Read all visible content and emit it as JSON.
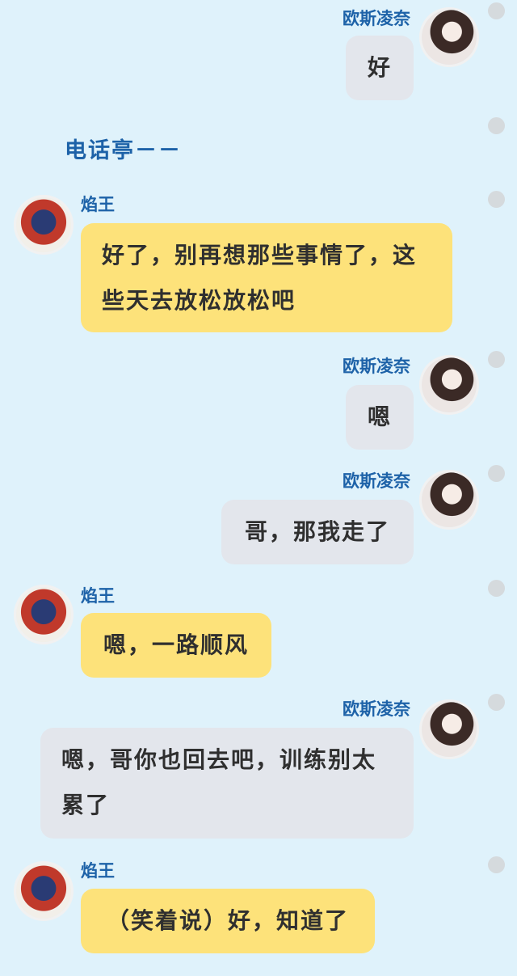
{
  "scene_note": "电话亭－－",
  "messages": [
    {
      "sender": "欧斯凌奈",
      "lines": [
        "好"
      ]
    },
    {
      "sender": "焰王",
      "lines": [
        "好了，别再想那些事情了，这",
        "些天去放松放松吧"
      ]
    },
    {
      "sender": "欧斯凌奈",
      "lines": [
        "嗯"
      ]
    },
    {
      "sender": "欧斯凌奈",
      "lines": [
        "哥，那我走了"
      ]
    },
    {
      "sender": "焰王",
      "lines": [
        "嗯，一路顺风"
      ]
    },
    {
      "sender": "欧斯凌奈",
      "lines": [
        "嗯，哥你也回去吧，训练别太",
        "累了"
      ]
    },
    {
      "sender": "焰王",
      "lines": [
        "（笑着说）好，知道了"
      ]
    }
  ],
  "colors": {
    "background": "#dff2fb",
    "name": "#1d62a8",
    "gray_bubble": "#e3e6ec",
    "yellow_bubble": "#fde27a"
  },
  "icons": [
    "girl-avatar",
    "boy-avatar",
    "scroll-dot"
  ]
}
